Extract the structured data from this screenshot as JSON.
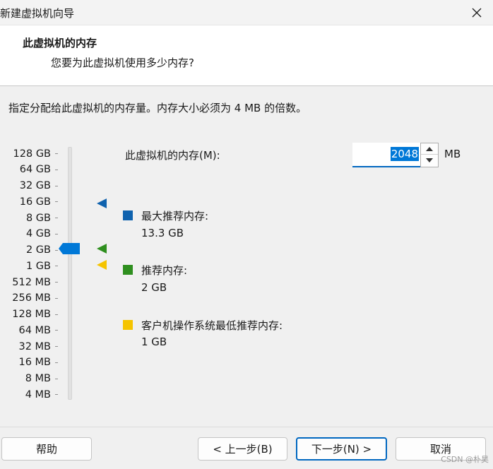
{
  "window": {
    "title": "新建虚拟机向导"
  },
  "header": {
    "title": "此虚拟机的内存",
    "subtitle": "您要为此虚拟机使用多少内存?"
  },
  "instruction": "指定分配给此虚拟机的内存量。内存大小必须为 4 MB 的倍数。",
  "scale": {
    "labels": [
      "128 GB",
      "64 GB",
      "32 GB",
      "16 GB",
      "8 GB",
      "4 GB",
      "2 GB",
      "1 GB",
      "512 MB",
      "256 MB",
      "128 MB",
      "64 MB",
      "32 MB",
      "16 MB",
      "8 MB",
      "4 MB"
    ],
    "selected": "2 GB"
  },
  "memory": {
    "label": "此虚拟机的内存(M):",
    "value": "2048",
    "unit": "MB"
  },
  "legend": [
    {
      "label": "最大推荐内存:",
      "value": "13.3 GB",
      "color": "#0f62ae",
      "scale_value": "16 GB"
    },
    {
      "label": "推荐内存:",
      "value": "2 GB",
      "color": "#2f8f1f",
      "scale_value": "2 GB"
    },
    {
      "label": "客户机操作系统最低推荐内存:",
      "value": "1 GB",
      "color": "#f5c400",
      "scale_value": "1 GB"
    }
  ],
  "buttons": {
    "help": "帮助",
    "back": "< 上一步(B)",
    "next": "下一步(N) >",
    "cancel": "取消"
  },
  "watermark": "CSDN @朴昊"
}
